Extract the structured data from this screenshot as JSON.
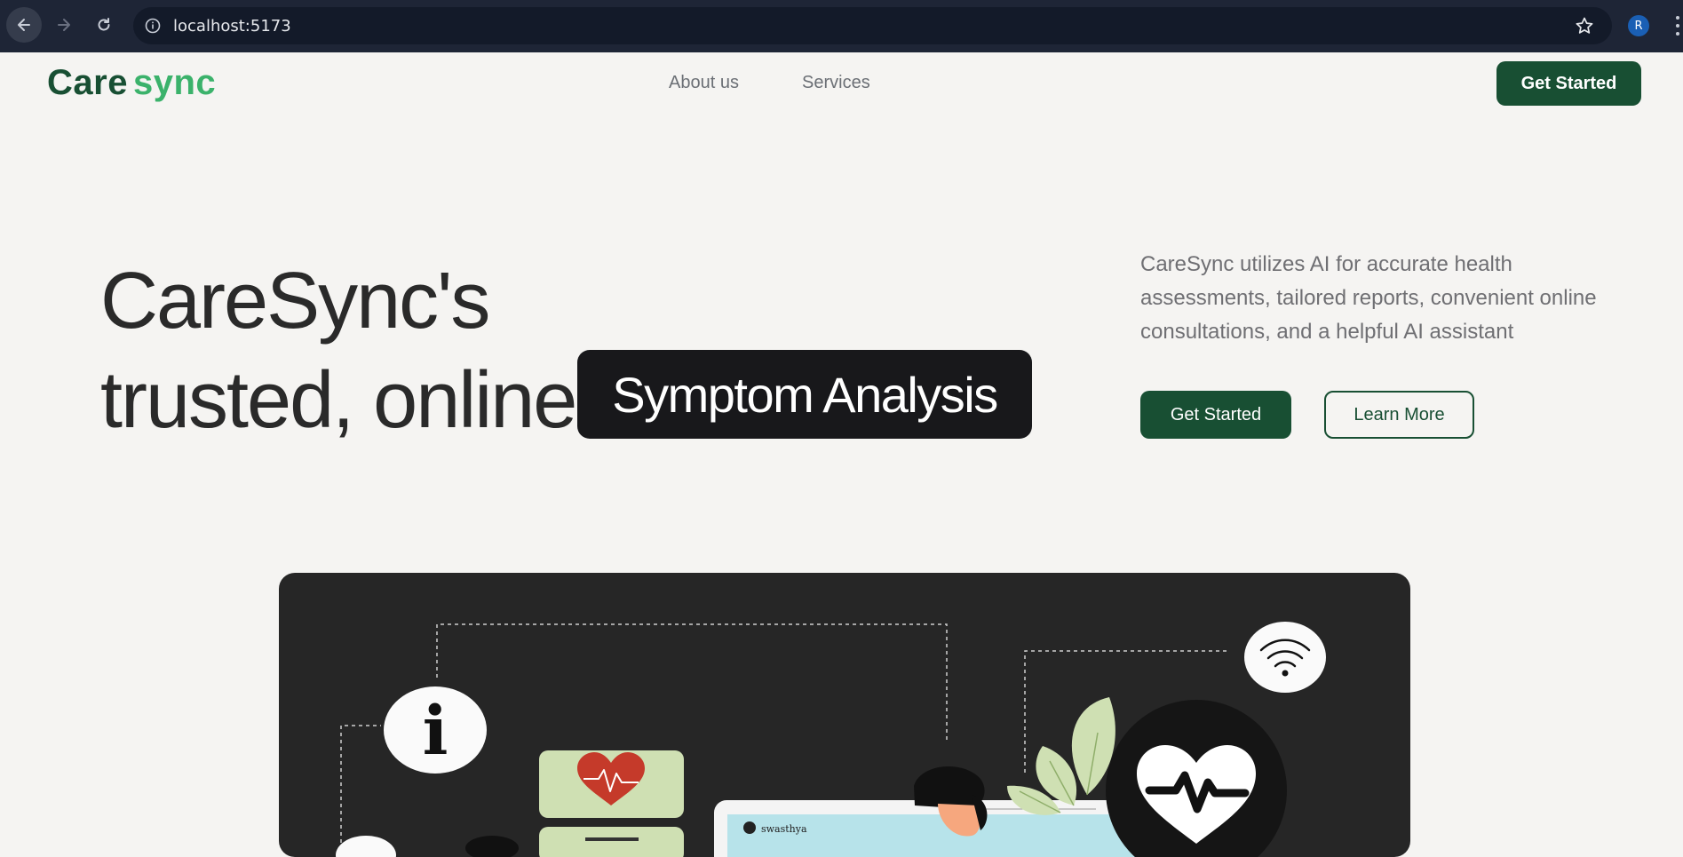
{
  "browser": {
    "url": "localhost:5173",
    "profile_initial": "R"
  },
  "nav": {
    "logo_part1": "Care",
    "logo_part2": "sync",
    "links": [
      "About us",
      "Services"
    ],
    "cta_label": "Get Started"
  },
  "hero": {
    "title_line1": "CareSync's",
    "title_line2": "trusted, online",
    "highlight": "Symptom Analysis",
    "description": "CareSync utilizes AI for accurate health assessments, tailored reports, convenient online consultations, and a helpful AI assistant",
    "primary_button": "Get Started",
    "secondary_button": "Learn More"
  },
  "illustration": {
    "info_glyph": "i",
    "screen_brand": "swasthya"
  },
  "colors": {
    "brand_dark": "#184f33",
    "brand_light": "#3bb26b",
    "page_bg": "#f5f4f2",
    "card_bg": "#262626"
  }
}
